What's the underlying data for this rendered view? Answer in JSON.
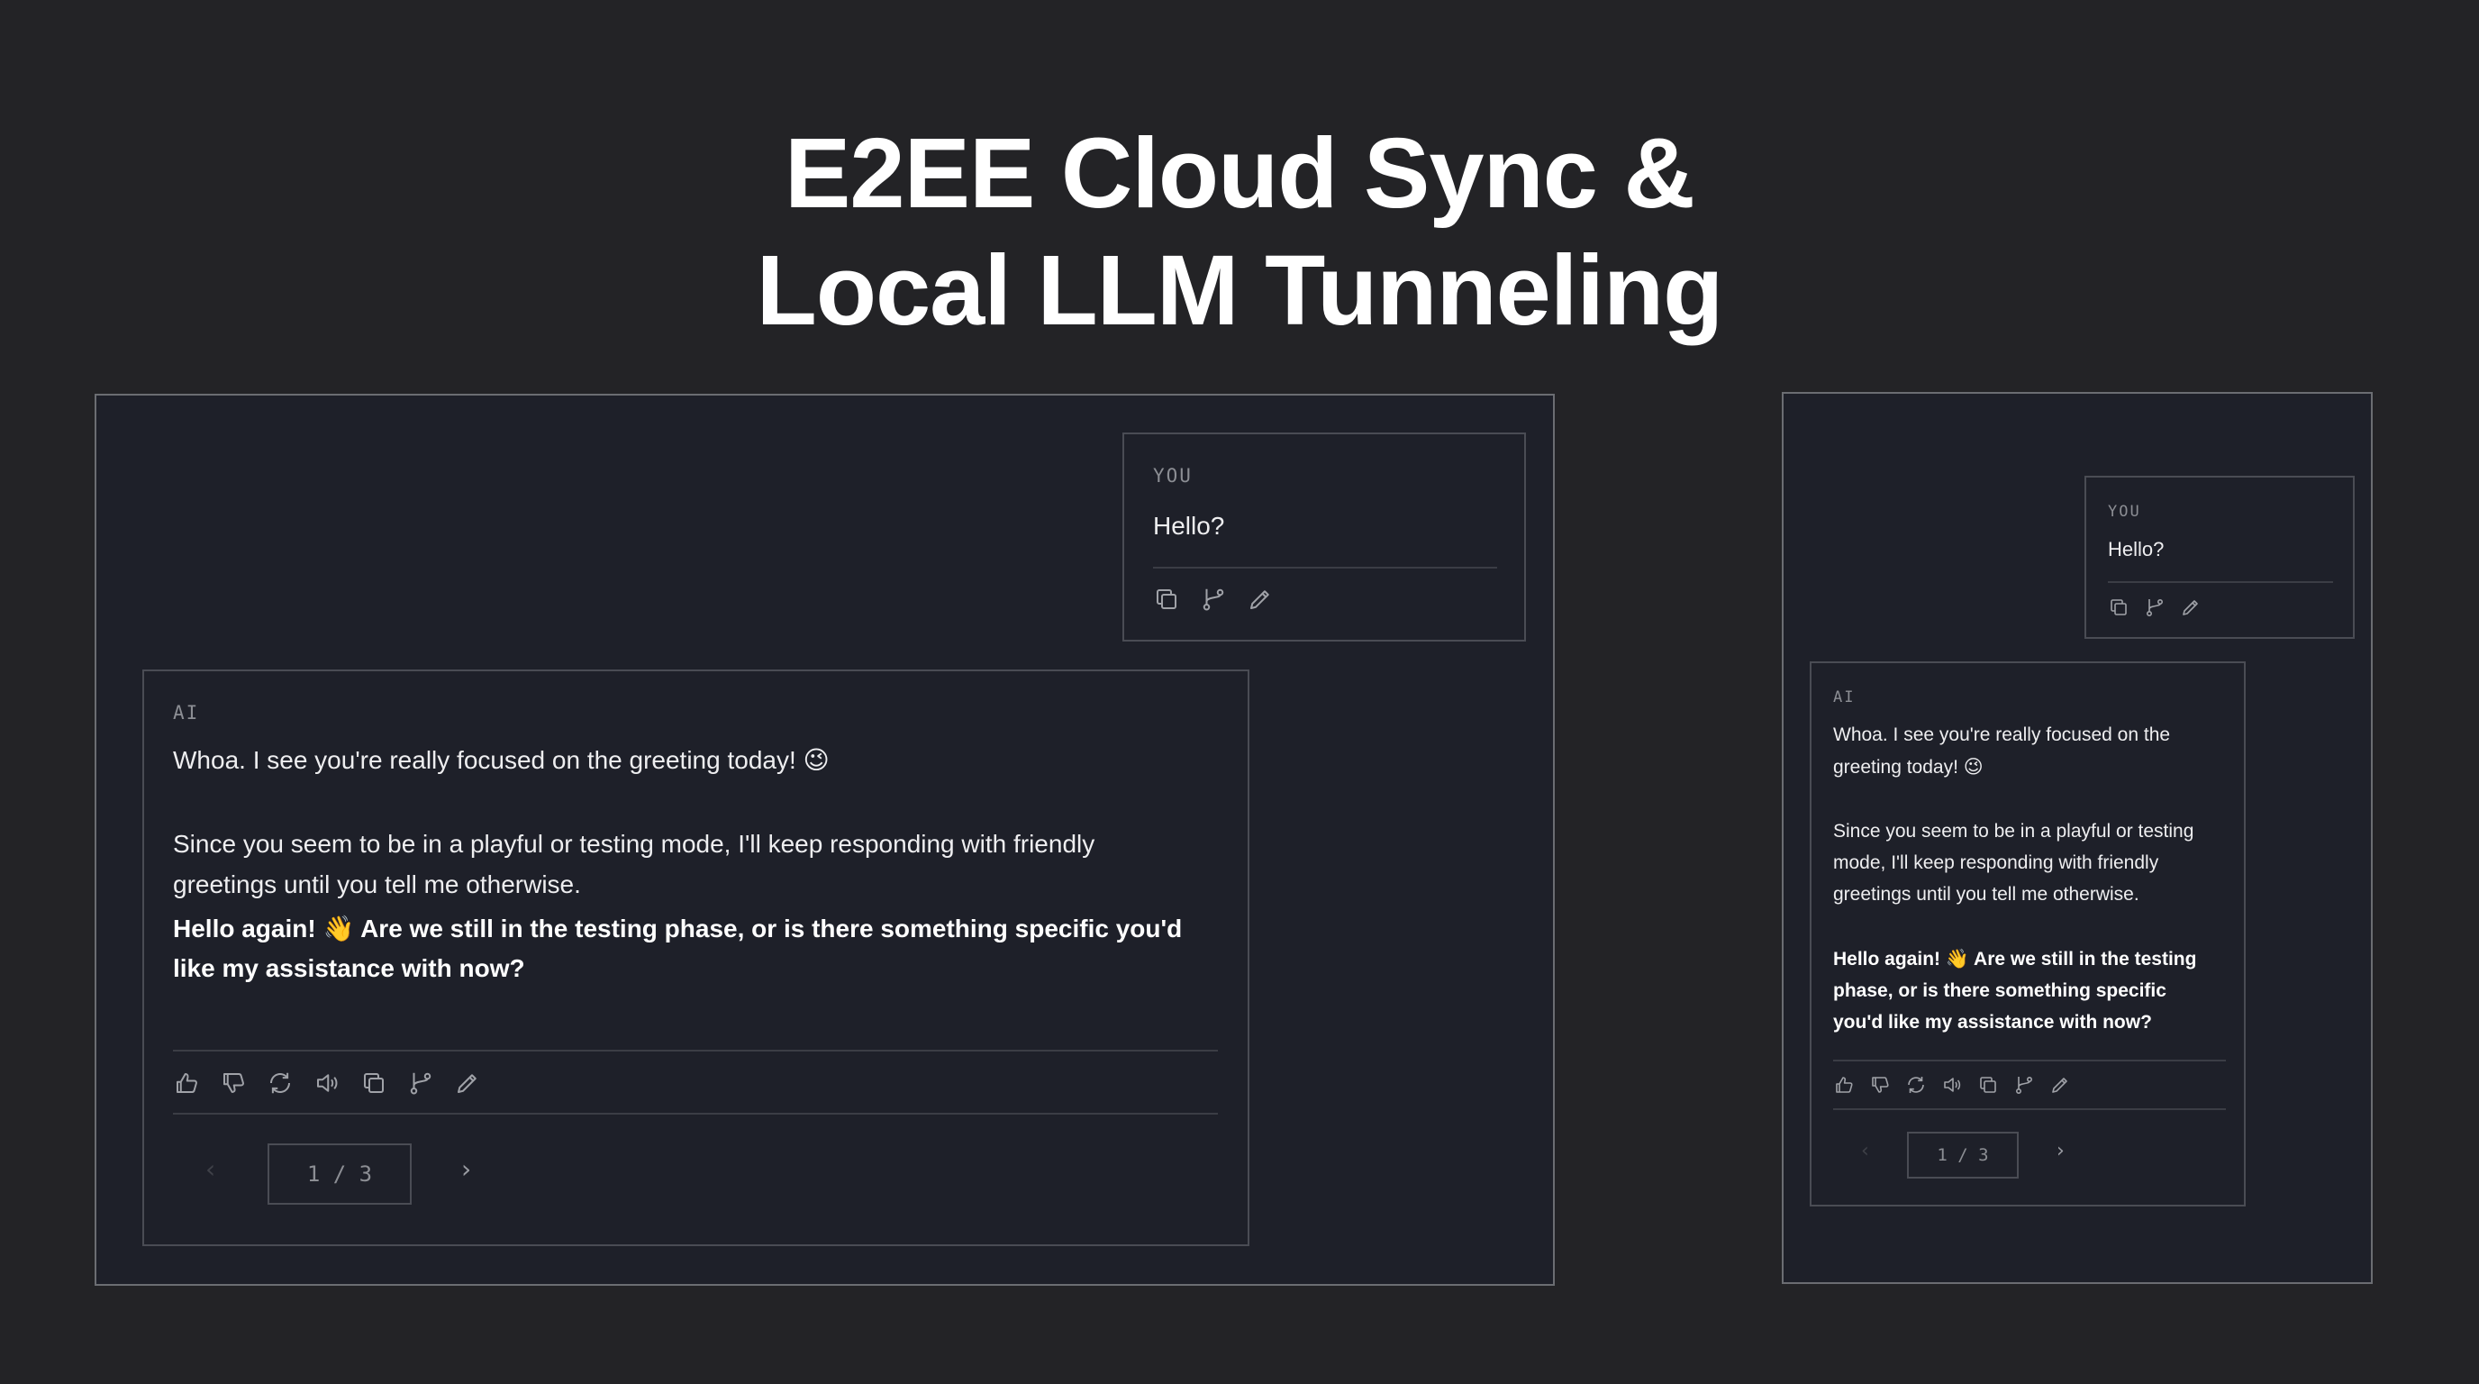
{
  "headline": {
    "line1": "E2EE Cloud Sync &",
    "line2": "Local LLM Tunneling"
  },
  "chat": {
    "user_role": "YOU",
    "user_message": "Hello?",
    "ai_role": "AI",
    "ai_p1": "Whoa. I see you're really focused on the greeting today! 😉",
    "ai_p2_line1": "Since you seem to be in a playful or testing mode, I'll keep responding with friendly",
    "ai_p2_line2": "greetings until you tell me otherwise.",
    "ai_p3_line1": "Hello again! 👋 Are we still in the testing phase, or is there something specific you'd",
    "ai_p3_line2": "like my assistance with now?",
    "pager": "1  /  3"
  },
  "mobile": {
    "ai_p1_line1": "Whoa. I see you're really focused on the",
    "ai_p1_line2": "greeting today! 😉",
    "ai_p2_line1": "Since you seem to be in a playful or testing",
    "ai_p2_line2": "mode, I'll keep responding with friendly",
    "ai_p2_line3": "greetings until you tell me otherwise.",
    "ai_p3_line1": "Hello again! 👋 Are we still in the testing",
    "ai_p3_line2": "phase, or is there something specific",
    "ai_p3_line3": "you'd like my assistance with now?"
  },
  "icons": {
    "user_actions": [
      "copy-icon",
      "branch-icon",
      "edit-icon"
    ],
    "ai_actions": [
      "thumbs-up-icon",
      "thumbs-down-icon",
      "regenerate-icon",
      "speaker-icon",
      "copy-icon",
      "branch-icon",
      "edit-icon"
    ],
    "pager": [
      "chevron-left-icon",
      "chevron-right-icon"
    ]
  },
  "colors": {
    "background": "#232326",
    "panel": "#1e2029",
    "border": "#4a4c54",
    "frame_border": "#6b6d72",
    "muted_text": "#8c8e94"
  }
}
